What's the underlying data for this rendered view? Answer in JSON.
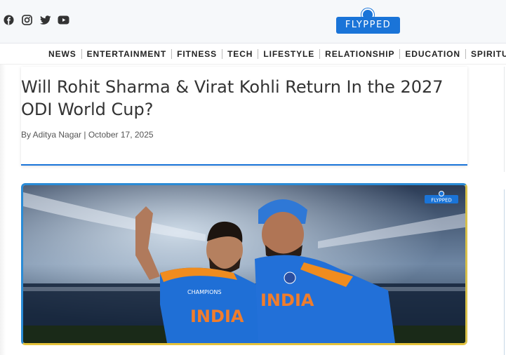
{
  "header": {
    "social": [
      {
        "name": "facebook-icon"
      },
      {
        "name": "instagram-icon"
      },
      {
        "name": "twitter-icon"
      },
      {
        "name": "youtube-icon"
      }
    ],
    "logo_text": "FLYPPED"
  },
  "nav": {
    "items": [
      "NEWS",
      "ENTERTAINMENT",
      "FITNESS",
      "TECH",
      "LIFESTYLE",
      "RELATIONSHIP",
      "EDUCATION",
      "SPIRITUAL"
    ]
  },
  "article": {
    "title": "Will Rohit Sharma & Virat Kohli Return In the 2027 ODI World Cup?",
    "byline": "By Aditya Nagar | October 17, 2025",
    "image": {
      "watermark": "FLYPPED",
      "jersey_text": "INDIA",
      "badge_text": "CHAMPIONS"
    }
  },
  "colors": {
    "brand": "#1a74d8",
    "jersey": "#1f6fd6"
  }
}
